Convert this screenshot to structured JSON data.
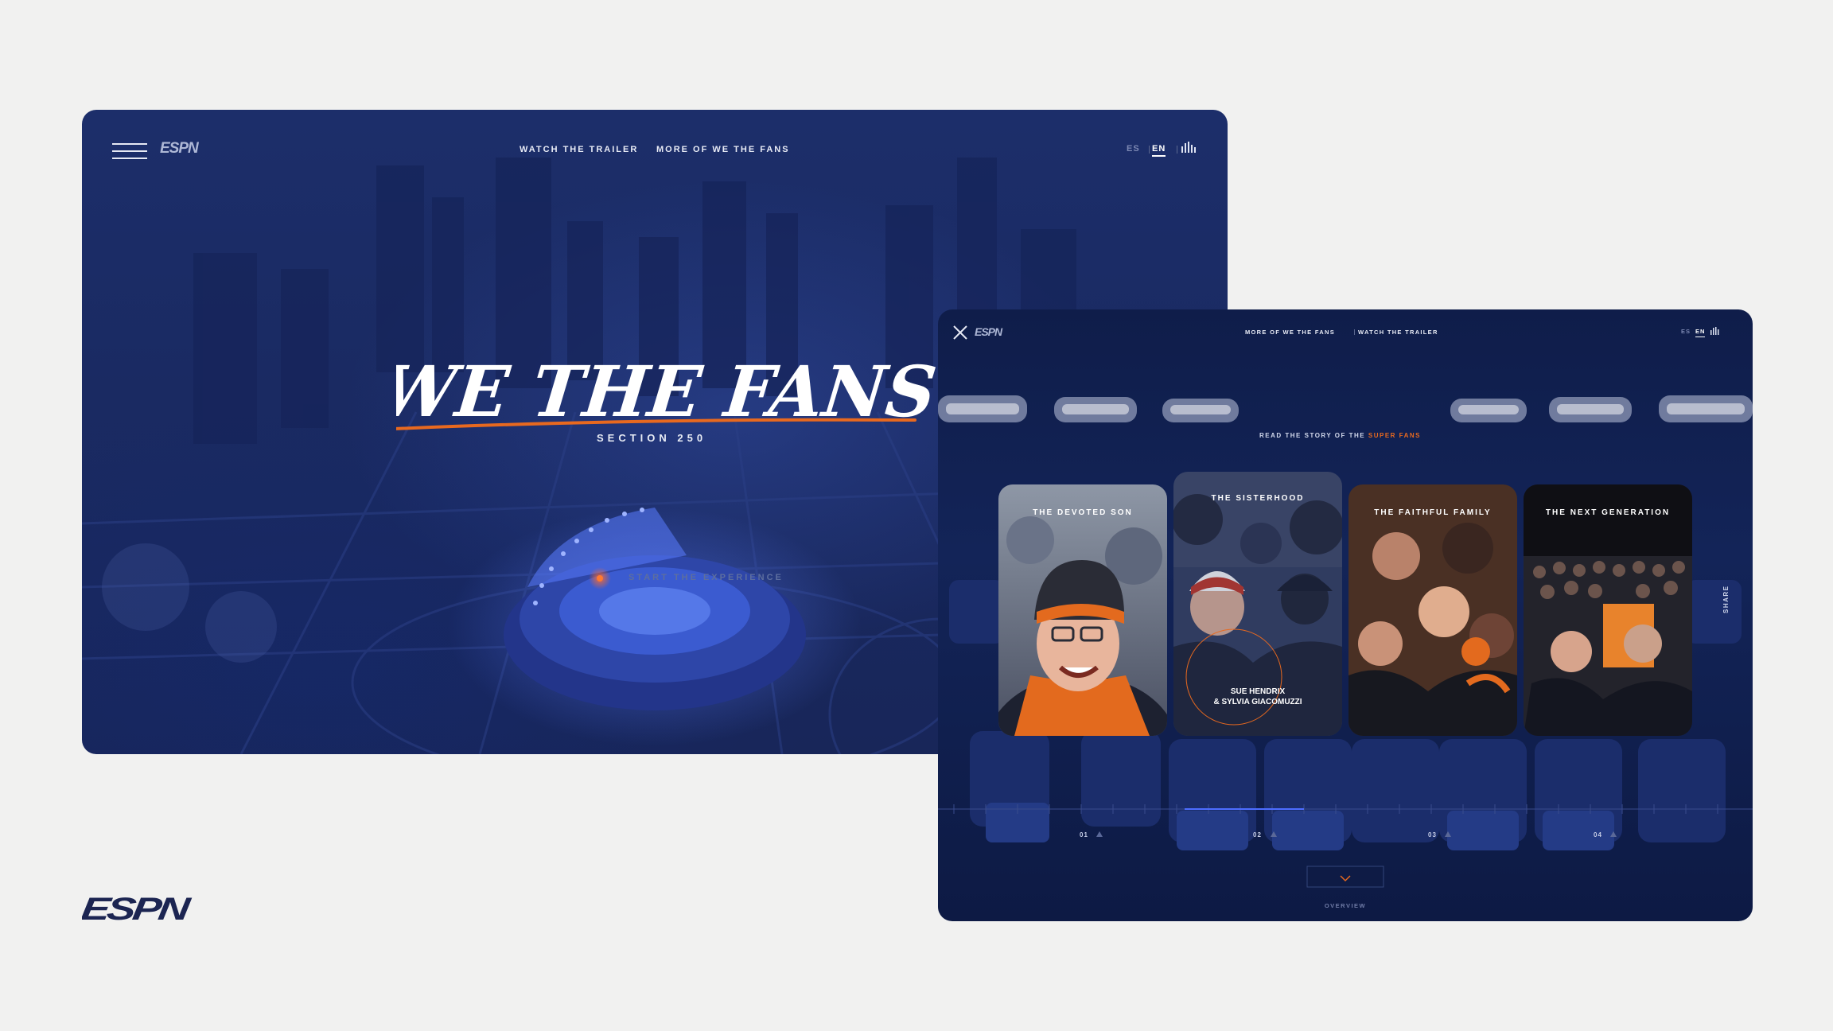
{
  "brand": {
    "name": "ESPN"
  },
  "colors": {
    "accent": "#e8691f",
    "bg_dark": "#1a2a62",
    "page": "#f1f1f0"
  },
  "window1": {
    "nav": {
      "menu_icon": "hamburger-icon",
      "links": [
        "WATCH THE TRAILER",
        "MORE OF WE THE FANS"
      ],
      "languages": [
        "ES",
        "EN"
      ],
      "active_language": "EN",
      "audio_icon": "sound-bars-icon"
    },
    "hero_title": "WE THE FANS",
    "subtitle": "SECTION 250",
    "cta": "START THE EXPERIENCE"
  },
  "window2": {
    "nav": {
      "close_icon": "close-icon",
      "links": [
        "MORE OF WE THE FANS",
        "WATCH THE TRAILER"
      ],
      "languages": [
        "ES",
        "EN"
      ],
      "active_language": "EN",
      "audio_icon": "sound-bars-icon"
    },
    "intro": {
      "prefix": "READ THE STORY OF THE",
      "highlight": "SUPER FANS"
    },
    "cards": [
      {
        "title": "THE DEVOTED SON",
        "number": "01"
      },
      {
        "title": "THE SISTERHOOD",
        "number": "02",
        "caption_line1": "SUE HENDRIX",
        "caption_line2": "& SYLVIA GIACOMUZZI"
      },
      {
        "title": "THE FAITHFUL FAMILY",
        "number": "03"
      },
      {
        "title": "THE NEXT GENERATION",
        "number": "04"
      }
    ],
    "share": "SHARE",
    "overview": "OVERVIEW"
  }
}
